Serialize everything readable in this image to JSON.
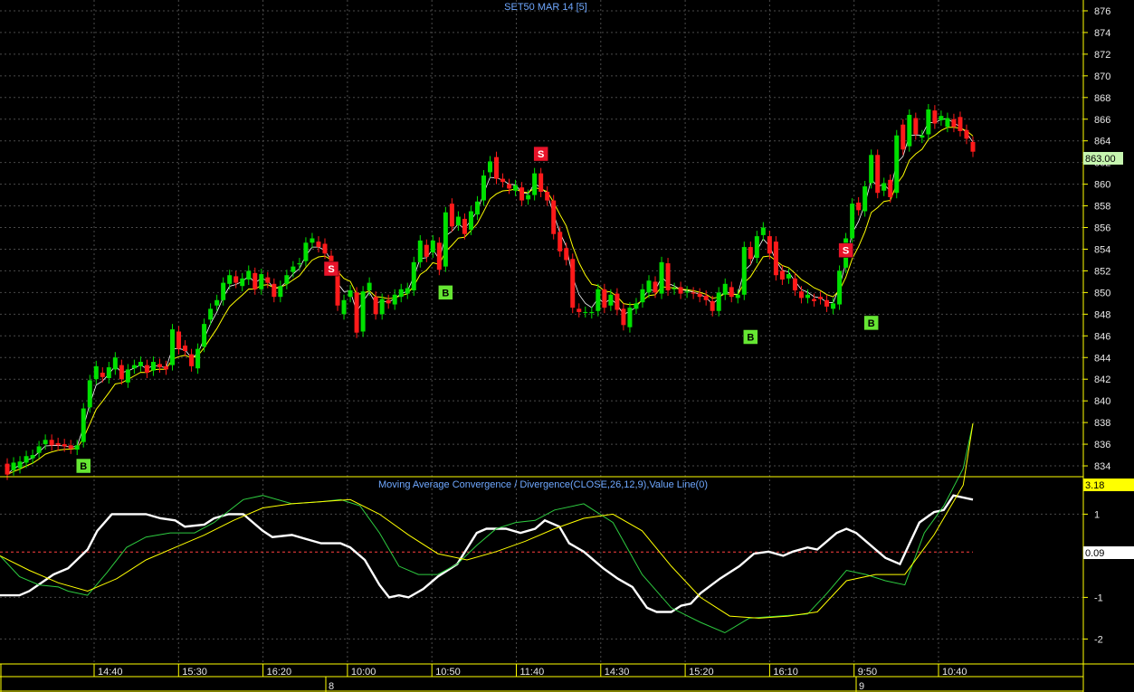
{
  "chart_data": [
    {
      "type": "candlestick",
      "title": "SET50 MAR 14  [5]",
      "ylim": [
        833,
        877
      ],
      "yticks": [
        834,
        836,
        838,
        840,
        842,
        844,
        846,
        848,
        850,
        852,
        854,
        856,
        858,
        860,
        862,
        864,
        866,
        868,
        870,
        872,
        874,
        876
      ],
      "last_price_label": "863.00",
      "last_price": 863.0,
      "candles_oc": [
        [
          834.2,
          833.2
        ],
        [
          833.6,
          834.3
        ],
        [
          833.8,
          834.4
        ],
        [
          834.3,
          834.9
        ],
        [
          834.7,
          835.0
        ],
        [
          835.2,
          835.8
        ],
        [
          836.0,
          836.4
        ],
        [
          836.4,
          835.9
        ],
        [
          836.1,
          835.9
        ],
        [
          836.0,
          835.8
        ],
        [
          835.9,
          835.6
        ],
        [
          835.5,
          835.9
        ],
        [
          836.2,
          839.3
        ],
        [
          839.4,
          841.9
        ],
        [
          842.0,
          843.2
        ],
        [
          842.6,
          842.2
        ],
        [
          842.1,
          843.1
        ],
        [
          842.9,
          844.0
        ],
        [
          843.3,
          842.0
        ],
        [
          841.7,
          842.9
        ],
        [
          843.0,
          843.3
        ],
        [
          843.2,
          843.6
        ],
        [
          843.3,
          842.6
        ],
        [
          842.8,
          843.6
        ],
        [
          843.4,
          843.1
        ],
        [
          843.2,
          842.9
        ],
        [
          843.3,
          846.6
        ],
        [
          846.4,
          844.8
        ],
        [
          845.1,
          844.6
        ],
        [
          844.3,
          843.2
        ],
        [
          843.0,
          844.8
        ],
        [
          845.0,
          847.1
        ],
        [
          847.5,
          848.5
        ],
        [
          848.8,
          849.3
        ],
        [
          849.3,
          850.9
        ],
        [
          850.8,
          851.6
        ],
        [
          851.5,
          850.9
        ],
        [
          850.6,
          851.3
        ],
        [
          851.2,
          852.0
        ],
        [
          851.8,
          850.3
        ],
        [
          850.3,
          851.7
        ],
        [
          851.4,
          850.9
        ],
        [
          850.8,
          849.6
        ],
        [
          849.6,
          850.6
        ],
        [
          850.8,
          851.6
        ],
        [
          851.9,
          852.4
        ],
        [
          852.6,
          852.7
        ],
        [
          852.9,
          854.6
        ],
        [
          854.6,
          855.0
        ],
        [
          854.7,
          854.2
        ],
        [
          854.5,
          853.6
        ],
        [
          853.4,
          852.0
        ],
        [
          852.0,
          848.8
        ],
        [
          848.0,
          849.3
        ],
        [
          849.6,
          850.2
        ],
        [
          850.0,
          846.3
        ],
        [
          846.4,
          850.1
        ],
        [
          850.2,
          850.9
        ],
        [
          849.6,
          848.0
        ],
        [
          848.0,
          849.4
        ],
        [
          849.3,
          849.0
        ],
        [
          848.9,
          849.8
        ],
        [
          849.6,
          850.3
        ],
        [
          849.9,
          850.4
        ],
        [
          850.2,
          852.8
        ],
        [
          852.8,
          854.8
        ],
        [
          854.4,
          853.3
        ],
        [
          853.7,
          854.8
        ],
        [
          854.6,
          852.1
        ],
        [
          852.4,
          857.4
        ],
        [
          858.2,
          856.1
        ],
        [
          856.2,
          857.0
        ],
        [
          856.8,
          855.4
        ],
        [
          855.8,
          857.5
        ],
        [
          857.2,
          858.4
        ],
        [
          858.5,
          860.8
        ],
        [
          861.1,
          862.1
        ],
        [
          862.5,
          860.5
        ],
        [
          860.5,
          860.2
        ],
        [
          860.0,
          859.6
        ],
        [
          859.4,
          859.9
        ],
        [
          859.7,
          858.5
        ],
        [
          858.6,
          859.0
        ],
        [
          859.0,
          861.0
        ],
        [
          861.0,
          859.3
        ],
        [
          859.3,
          858.5
        ],
        [
          858.5,
          855.4
        ],
        [
          855.6,
          853.8
        ],
        [
          854.1,
          853.0
        ],
        [
          853.1,
          848.6
        ],
        [
          848.5,
          848.2
        ],
        [
          848.2,
          848.2
        ],
        [
          848.1,
          848.2
        ],
        [
          848.3,
          850.3
        ],
        [
          850.3,
          848.6
        ],
        [
          848.8,
          849.8
        ],
        [
          849.9,
          848.4
        ],
        [
          848.5,
          847.0
        ],
        [
          846.8,
          848.6
        ],
        [
          848.5,
          849.0
        ],
        [
          849.1,
          850.3
        ],
        [
          850.0,
          851.1
        ],
        [
          851.0,
          850.0
        ],
        [
          849.9,
          852.8
        ],
        [
          852.7,
          850.2
        ],
        [
          850.3,
          850.4
        ],
        [
          850.5,
          849.9
        ],
        [
          850.0,
          850.1
        ],
        [
          850.0,
          849.9
        ],
        [
          849.9,
          849.6
        ],
        [
          849.7,
          849.3
        ],
        [
          849.2,
          848.3
        ],
        [
          848.3,
          850.0
        ],
        [
          849.8,
          850.8
        ],
        [
          850.5,
          849.6
        ],
        [
          849.5,
          849.8
        ],
        [
          849.8,
          854.2
        ],
        [
          854.2,
          853.1
        ],
        [
          853.2,
          855.2
        ],
        [
          855.3,
          856.0
        ],
        [
          855.2,
          853.6
        ],
        [
          854.7,
          851.6
        ],
        [
          852.0,
          851.2
        ],
        [
          851.3,
          851.7
        ],
        [
          851.3,
          850.2
        ],
        [
          850.1,
          849.5
        ],
        [
          849.5,
          849.8
        ],
        [
          849.4,
          849.2
        ],
        [
          849.6,
          849.4
        ],
        [
          849.3,
          848.7
        ],
        [
          848.5,
          849.0
        ],
        [
          848.9,
          852.0
        ],
        [
          852.3,
          855.0
        ],
        [
          855.0,
          858.2
        ],
        [
          858.3,
          857.6
        ],
        [
          857.5,
          859.8
        ],
        [
          860.1,
          862.7
        ],
        [
          862.7,
          859.2
        ],
        [
          859.4,
          860.1
        ],
        [
          860.4,
          858.8
        ],
        [
          859.2,
          864.5
        ],
        [
          865.5,
          863.2
        ],
        [
          863.5,
          866.4
        ],
        [
          866.1,
          864.6
        ],
        [
          864.3,
          864.5
        ],
        [
          864.6,
          866.9
        ],
        [
          866.8,
          865.6
        ],
        [
          865.9,
          866.3
        ],
        [
          865.3,
          866.1
        ],
        [
          866.0,
          865.3
        ],
        [
          866.2,
          864.9
        ],
        [
          865.0,
          864.2
        ],
        [
          863.9,
          863.0
        ]
      ],
      "signals": [
        {
          "label": "B",
          "candle_index": 12,
          "price": 834.0
        },
        {
          "label": "S",
          "candle_index": 51,
          "price": 852.2
        },
        {
          "label": "B",
          "candle_index": 69,
          "price": 850.0
        },
        {
          "label": "S",
          "candle_index": 84,
          "price": 862.8
        },
        {
          "label": "B",
          "candle_index": 117,
          "price": 845.9
        },
        {
          "label": "S",
          "candle_index": 132,
          "price": 853.9
        },
        {
          "label": "B",
          "candle_index": 136,
          "price": 847.2
        }
      ],
      "moving_average_colors": [
        "#ffffff",
        "#ffff00"
      ]
    },
    {
      "type": "line",
      "title": "Moving Average Convergence / Divergence(CLOSE,26,12,9),Value Line(0)",
      "ylim": [
        -2.6,
        1.9
      ],
      "yticks": [
        1,
        -1,
        -2
      ],
      "last_value_label": "3.18",
      "zero_line_label": "0.09",
      "zero_line_value": 0.09,
      "series": [
        {
          "color": "#ffffff",
          "x_fraction": [
            0,
            0.02,
            0.03,
            0.055,
            0.07,
            0.09,
            0.1,
            0.115,
            0.13,
            0.15,
            0.165,
            0.18,
            0.19,
            0.21,
            0.22,
            0.235,
            0.25,
            0.27,
            0.28,
            0.3,
            0.315,
            0.33,
            0.34,
            0.35,
            0.36,
            0.375,
            0.39,
            0.4,
            0.41,
            0.42,
            0.435,
            0.45,
            0.47,
            0.49,
            0.5,
            0.52,
            0.535,
            0.55,
            0.56,
            0.575,
            0.585,
            0.6,
            0.62,
            0.635,
            0.65,
            0.665,
            0.675,
            0.69,
            0.7,
            0.71,
            0.72,
            0.74,
            0.76,
            0.775,
            0.79,
            0.805,
            0.815,
            0.83,
            0.84,
            0.85,
            0.86,
            0.87,
            0.88,
            0.89,
            0.9,
            0.91,
            0.925,
            0.935,
            0.945,
            0.96,
            0.97,
            0.98,
            1.0
          ],
          "values": [
            -0.95,
            -0.95,
            -0.85,
            -0.45,
            -0.3,
            0.15,
            0.6,
            1.0,
            1.0,
            1.0,
            0.9,
            0.85,
            0.7,
            0.75,
            0.9,
            1.0,
            1.0,
            0.6,
            0.45,
            0.5,
            0.4,
            0.3,
            0.3,
            0.3,
            0.2,
            -0.1,
            -0.7,
            -1.0,
            -0.95,
            -1.0,
            -0.8,
            -0.5,
            -0.2,
            0.55,
            0.65,
            0.65,
            0.55,
            0.65,
            0.85,
            0.7,
            0.3,
            0.1,
            -0.3,
            -0.55,
            -0.75,
            -1.25,
            -1.35,
            -1.35,
            -1.2,
            -1.15,
            -0.9,
            -0.55,
            -0.25,
            0.05,
            0.1,
            0.0,
            0.1,
            0.2,
            0.15,
            0.35,
            0.55,
            0.65,
            0.55,
            0.35,
            0.15,
            -0.05,
            -0.2,
            0.3,
            0.8,
            1.05,
            1.1,
            1.45,
            1.35
          ]
        },
        {
          "color": "#2ecc40",
          "x_fraction": [
            0,
            0.02,
            0.04,
            0.06,
            0.07,
            0.09,
            0.11,
            0.13,
            0.15,
            0.175,
            0.2,
            0.22,
            0.25,
            0.27,
            0.3,
            0.33,
            0.35,
            0.37,
            0.39,
            0.41,
            0.43,
            0.45,
            0.47,
            0.49,
            0.51,
            0.53,
            0.55,
            0.57,
            0.6,
            0.63,
            0.66,
            0.69,
            0.72,
            0.745,
            0.77,
            0.8,
            0.83,
            0.85,
            0.87,
            0.89,
            0.91,
            0.93,
            0.95,
            0.97,
            0.99,
            1.0
          ],
          "values": [
            0.0,
            -0.5,
            -0.7,
            -0.75,
            -0.85,
            -0.95,
            -0.4,
            0.2,
            0.45,
            0.55,
            0.55,
            0.8,
            1.35,
            1.45,
            1.25,
            1.3,
            1.35,
            1.2,
            0.55,
            -0.25,
            -0.45,
            -0.45,
            -0.2,
            0.25,
            0.65,
            0.8,
            0.85,
            1.1,
            1.25,
            0.8,
            -0.45,
            -1.25,
            -1.6,
            -1.85,
            -1.5,
            -1.45,
            -1.4,
            -0.9,
            -0.35,
            -0.45,
            -0.6,
            -0.7,
            0.55,
            1.2,
            2.1,
            3.18
          ]
        },
        {
          "color": "#ffff00",
          "x_fraction": [
            0,
            0.03,
            0.06,
            0.09,
            0.12,
            0.15,
            0.18,
            0.21,
            0.24,
            0.27,
            0.3,
            0.33,
            0.36,
            0.39,
            0.42,
            0.45,
            0.48,
            0.51,
            0.54,
            0.57,
            0.6,
            0.63,
            0.66,
            0.69,
            0.72,
            0.75,
            0.78,
            0.81,
            0.84,
            0.87,
            0.9,
            0.93,
            0.96,
            0.99,
            1.0
          ],
          "values": [
            0.0,
            -0.35,
            -0.65,
            -0.85,
            -0.55,
            -0.1,
            0.2,
            0.5,
            0.85,
            1.15,
            1.25,
            1.3,
            1.35,
            1.0,
            0.5,
            0.05,
            -0.1,
            0.1,
            0.35,
            0.65,
            0.9,
            1.0,
            0.6,
            -0.25,
            -1.0,
            -1.45,
            -1.5,
            -1.45,
            -1.35,
            -0.6,
            -0.45,
            -0.45,
            0.5,
            1.7,
            3.18
          ]
        }
      ]
    }
  ],
  "x_axis": {
    "time_labels": [
      "14:40",
      "15:30",
      "16:20",
      "10:00",
      "10:50",
      "11:40",
      "14:30",
      "15:20",
      "16:10",
      "9:50",
      "10:40"
    ],
    "day_labels": [
      "8",
      "9"
    ]
  }
}
